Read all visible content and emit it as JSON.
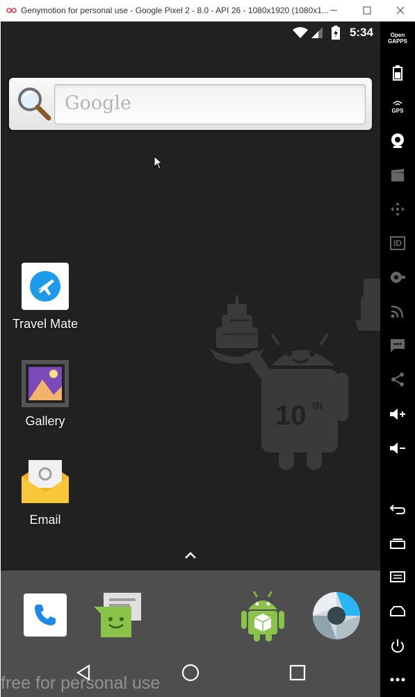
{
  "window": {
    "title": "Genymotion for personal use - Google Pixel 2 - 8.0 - API 26 - 1080x1920 (1080x1...",
    "minimize_icon": "minimize-icon",
    "maximize_icon": "maximize-icon",
    "close_icon": "close-icon"
  },
  "statusbar": {
    "time": "5:34",
    "icons": [
      "wifi-icon",
      "cell-signal-icon",
      "battery-charging-icon"
    ]
  },
  "search": {
    "placeholder": "Google",
    "icon": "magnifier-icon"
  },
  "home_apps": [
    {
      "label": "Travel Mate",
      "icon": "travel-mate-icon"
    },
    {
      "label": "Gallery",
      "icon": "gallery-icon"
    },
    {
      "label": "Email",
      "icon": "email-icon"
    }
  ],
  "wallpaper": {
    "badge_text": "10",
    "badge_sup": "th"
  },
  "dock": {
    "apps": [
      "phone-icon",
      "messaging-icon",
      "android-apk-icon",
      "camera-icon"
    ]
  },
  "navbar": {
    "buttons": [
      "back-icon",
      "home-icon",
      "recents-icon"
    ],
    "watermark": "free for personal use"
  },
  "sidebar": {
    "items": [
      {
        "name": "open-gapps",
        "label_line1": "Open",
        "label_line2": "GAPPS"
      },
      {
        "name": "battery",
        "icon": "battery-icon"
      },
      {
        "name": "gps",
        "label": "GPS"
      },
      {
        "name": "webcam",
        "icon": "webcam-icon"
      },
      {
        "name": "capture",
        "icon": "clapper-icon"
      },
      {
        "name": "dpad",
        "icon": "dpad-icon"
      },
      {
        "name": "identifiers",
        "label": "ID"
      },
      {
        "name": "disk-io",
        "icon": "disk-icon"
      },
      {
        "name": "network",
        "icon": "network-icon"
      },
      {
        "name": "sms",
        "icon": "sms-icon"
      },
      {
        "name": "share",
        "icon": "share-icon"
      },
      {
        "name": "volume-up",
        "icon": "volume-up-icon"
      },
      {
        "name": "volume-down",
        "icon": "volume-down-icon"
      },
      {
        "name": "back",
        "icon": "back-icon"
      },
      {
        "name": "recent",
        "icon": "recent-apps-icon"
      },
      {
        "name": "menu",
        "icon": "menu-icon"
      },
      {
        "name": "home",
        "icon": "home-icon"
      },
      {
        "name": "power",
        "icon": "power-icon"
      },
      {
        "name": "more",
        "icon": "more-icon"
      }
    ]
  }
}
